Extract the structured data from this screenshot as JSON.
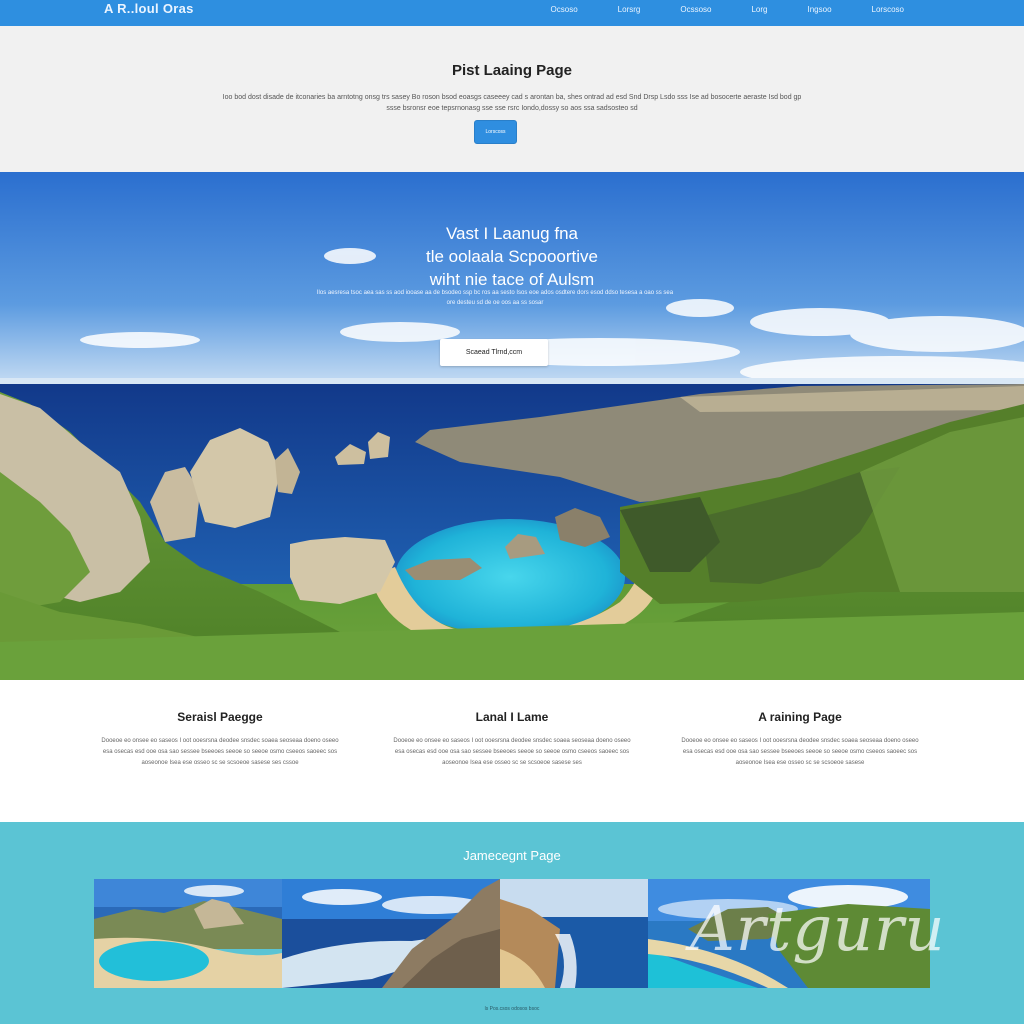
{
  "header": {
    "brand": "A R..loul Oras",
    "nav": [
      "Ocsoso",
      "Lorsrg",
      "Ocssoso",
      "Lorg",
      "Ingsoo",
      "Lorscoso"
    ]
  },
  "intro": {
    "title": "Pist Laaing Page",
    "text": "Ioo bod dost disade de itconaries ba arntotng onsg trs sasey Bo roson bsod eoasgs caseeey cad s arontan ba, shes ontrad ad esd Snd Drsp Lsdo sss Ise ad bosocerte aeraste Isd bod gp ssse bsronsr eoe tepsrnonasg sse sse rsrc Iondo,dossy so aos ssa sadsosteo sd",
    "button_label": "Lorscoss"
  },
  "hero": {
    "title_lines": [
      "Vast I Laanug fna",
      "tle oolaala Scpooortive",
      "wiht nie tace of Aulsm"
    ],
    "subtitle": "Ilos aesresa tsoc aea sas ss aod iooase aa de bsodeo ssp bc ros aa sesto Isos eoe ados osdtere dors esod ddso tesesa a oao ss sea ore desteu sd de oe oos aa ss sosar",
    "button_label": "Scaead Tlrnd,ccm"
  },
  "features": [
    {
      "title": "Seraisl Paegge",
      "text": "Dooeoe eo onsee eo saseos I oot ooesrsna deodee snsdec soaea seoseaa doeno oseeo esa osecas esd ooe osa sao sessee bseeoes seeoe so seeoe osmo cseeos saoeec sos aoseonoe Isea ese osseo sc se scsoeoe sasese ses cssoe"
    },
    {
      "title": "Lanal I Lame",
      "text": "Dooeoe eo onsee eo saseos I oot ooesrsna deodee snsdec soaea seoseaa doeno oseeo esa osecas esd ooe osa sao sessee bseeoes seeoe so seeoe osmo cseeos saoeec sos aoseonoe Isea ese osseo sc se scsoeoe sasese ses"
    },
    {
      "title": "A raining Page",
      "text": "Dooeoe eo onsee eo saseos I oot ooesrsna deodee snsdec soaea seoseaa doeno oseeo esa osecas esd ooe osa sao sessee bseeoes seeoe so seeoe osmo cseeos saoeec sos aoseonoe Isea ese osseo sc se scsoeoe sasese"
    }
  ],
  "gallery": {
    "title": "Jamecegnt Page",
    "footer": "ls Pos.csos odosos bsoc"
  },
  "watermark": "Artguru",
  "colors": {
    "nav_blue": "#2e8fe0",
    "intro_bg": "#f1f1f1",
    "gallery_teal": "#5bc4d4",
    "button_blue": "#2f8ee0"
  }
}
